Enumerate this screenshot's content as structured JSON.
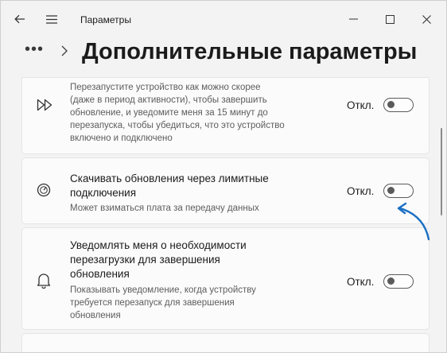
{
  "window": {
    "app_title": "Параметры",
    "back_icon": "back-arrow-icon",
    "menu_icon": "hamburger-icon"
  },
  "header": {
    "ellipsis": "•••",
    "title": "Дополнительные параметры"
  },
  "cards": [
    {
      "icon": "fast-forward-icon",
      "title": "",
      "description": "Перезапустите устройство как можно скорее (даже в период активности), чтобы завершить обновление, и уведомите меня за 15 минут до перезапуска, чтобы убедиться, что это устройство включено и подключено",
      "toggle_label": "Откл.",
      "toggle_on": false
    },
    {
      "icon": "speedometer-icon",
      "title": "Скачивать обновления через лимитные подключения",
      "description": "Может взиматься плата за передачу данных",
      "toggle_label": "Откл.",
      "toggle_on": false
    },
    {
      "icon": "bell-icon",
      "title": "Уведомлять меня о необходимости перезагрузки для завершения обновления",
      "description": "Показывать уведомление, когда устройству требуется перезапуск для завершения обновления",
      "toggle_label": "Откл.",
      "toggle_on": false
    }
  ],
  "colors": {
    "background": "#f3f3f3",
    "card": "#fbfbfb",
    "annotation_arrow": "#1a6fc4"
  }
}
